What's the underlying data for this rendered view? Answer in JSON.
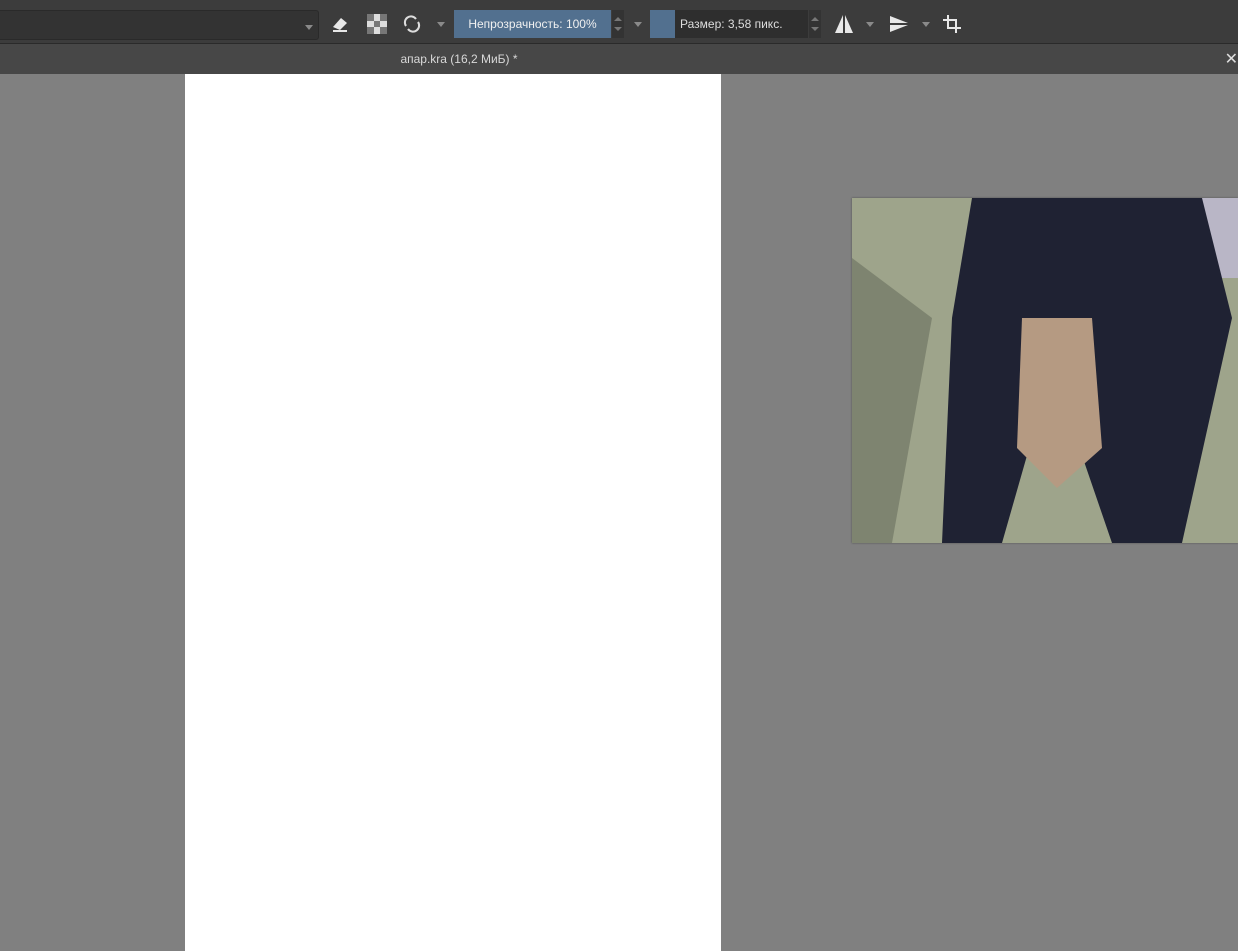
{
  "toolbar": {
    "brush_preset": "",
    "icons": [
      "eraser-icon",
      "alpha-lock-icon",
      "reload-preset-icon",
      "mirror-horizontal-icon",
      "mirror-vertical-icon",
      "crop-icon"
    ],
    "opacity_label": "Непрозрачность: 100%",
    "opacity_percent": 100,
    "size_label": "Размер: 3,58 пикс."
  },
  "document": {
    "title": "апар.kra (16,2 МиБ) *"
  },
  "colors": {
    "accent": "#52708f",
    "background": "#808080",
    "toolbar": "#3c3c3c"
  }
}
